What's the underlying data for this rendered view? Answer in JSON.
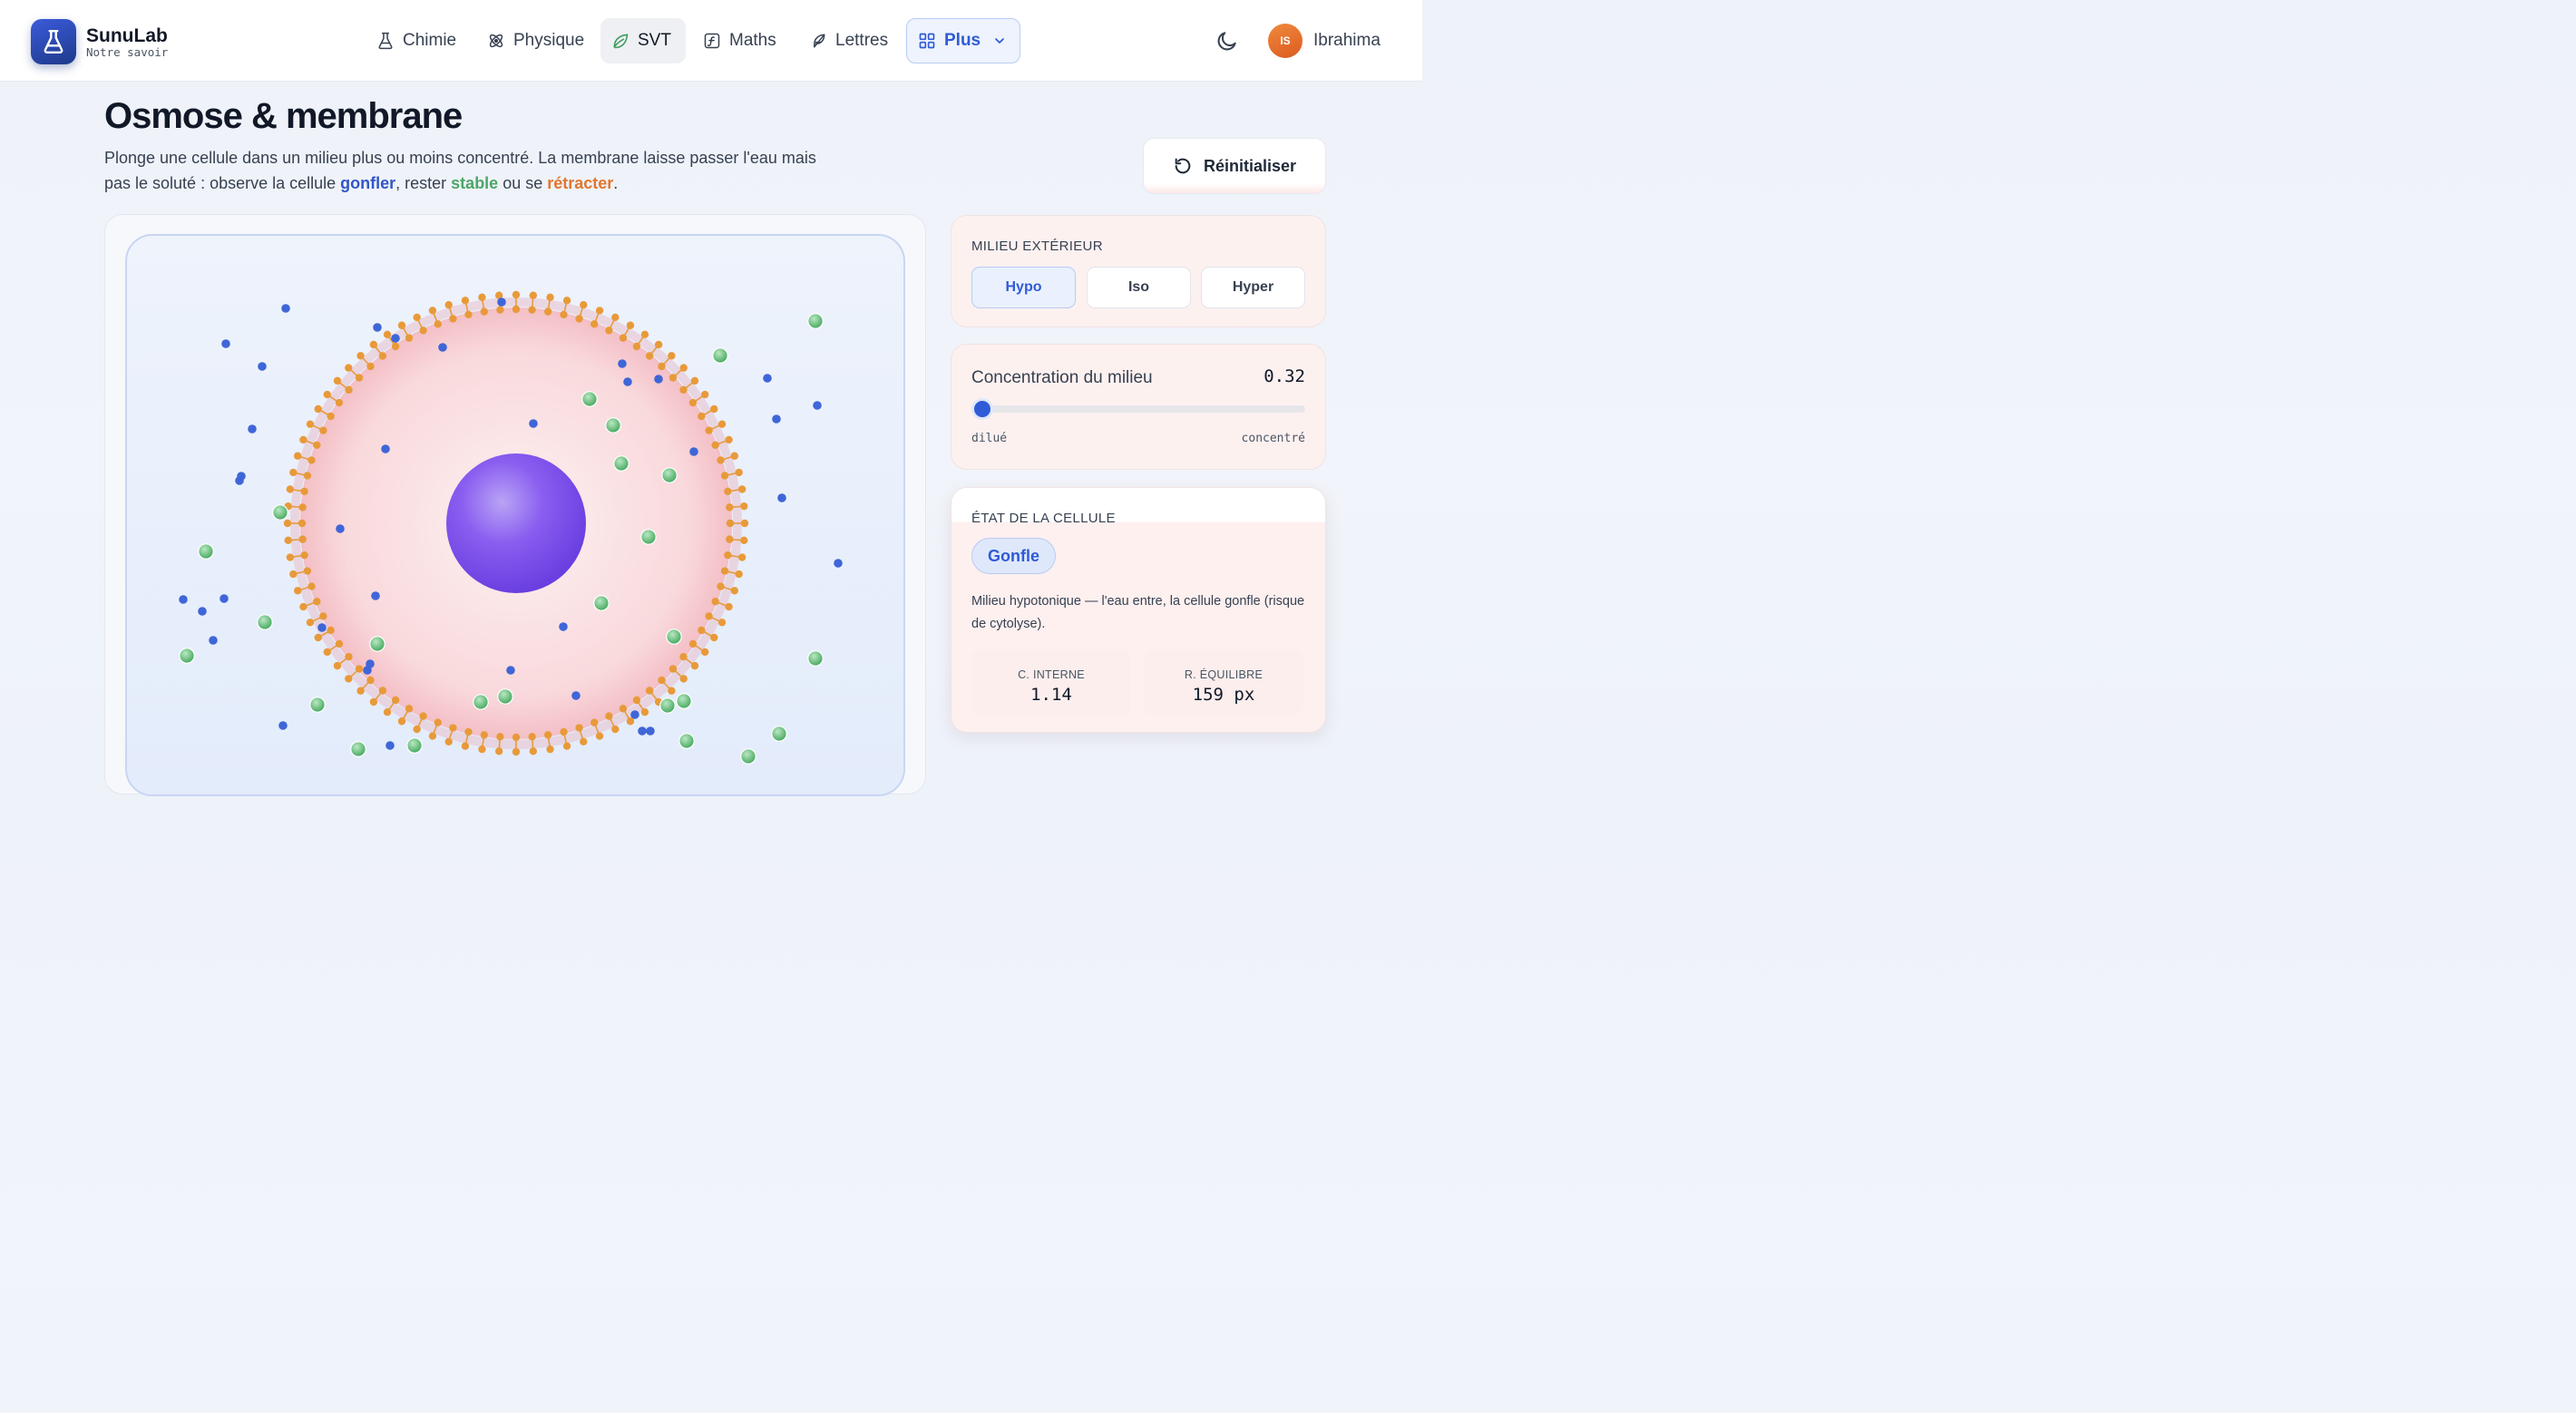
{
  "brand": {
    "name": "SunuLab",
    "tagline": "Notre savoir"
  },
  "nav": {
    "items": [
      {
        "label": "Chimie",
        "icon": "flask-icon"
      },
      {
        "label": "Physique",
        "icon": "atom-icon"
      },
      {
        "label": "SVT",
        "icon": "leaf-icon",
        "active": true
      },
      {
        "label": "Maths",
        "icon": "function-icon"
      },
      {
        "label": "Lettres",
        "icon": "feather-icon"
      }
    ],
    "more_label": "Plus",
    "theme_icon": "moon-icon",
    "user": {
      "initials": "IS",
      "name": "Ibrahima"
    }
  },
  "page": {
    "title": "Osmose & membrane",
    "desc_1": "Plonge une cellule dans un milieu plus ou moins concentré. La membrane laisse passer l'eau mais pas le soluté : observe la cellule ",
    "word_swell": "gonfler",
    "desc_2": ", rester ",
    "word_stable": "stable",
    "desc_3": " ou se ",
    "word_shrink": "rétracter",
    "desc_4": "."
  },
  "reset_label": "Réinitialiser",
  "medium": {
    "label": "MILIEU EXTÉRIEUR",
    "options": [
      "Hypo",
      "Iso",
      "Hyper"
    ],
    "selected": "Hypo"
  },
  "concentration": {
    "label": "Concentration du milieu",
    "value": "0.32",
    "fraction": 0.0,
    "min_label": "dilué",
    "max_label": "concentré"
  },
  "cell_state": {
    "label": "ÉTAT DE LA CELLULE",
    "badge": "Gonfle",
    "description": "Milieu hypotonique — l'eau entre, la cellule gonfle (risque de cytolyse).",
    "stats": [
      {
        "key": "C. INTERNE",
        "value": "1.14"
      },
      {
        "key": "R. ÉQUILIBRE",
        "value": "159 px"
      }
    ]
  },
  "colors": {
    "accent": "#2f5bd6",
    "water": "#3f66d8",
    "solute": "#5dbb72",
    "lipid": "#e89a3a",
    "nucleus": "#7b4de6",
    "cytoplasm": "#fadada"
  }
}
